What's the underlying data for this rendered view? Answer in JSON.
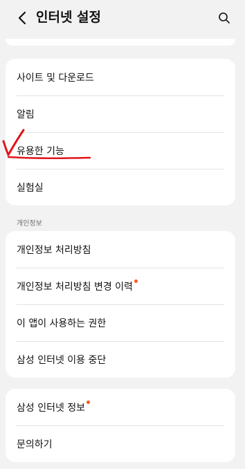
{
  "header": {
    "title": "인터넷 설정",
    "back_icon": "chevron-left-icon",
    "search_icon": "search-icon"
  },
  "group1": {
    "items": [
      {
        "label": "사이트 및 다운로드"
      },
      {
        "label": "알림"
      },
      {
        "label": "유용한 기능"
      },
      {
        "label": "실험실"
      }
    ]
  },
  "section2": {
    "label": "개인정보",
    "items": [
      {
        "label": "개인정보 처리방침"
      },
      {
        "label": "개인정보 처리방침 변경 이력"
      },
      {
        "label": "이 앱이 사용하는 권한"
      },
      {
        "label": "삼성 인터넷 이용 중단"
      }
    ]
  },
  "group3": {
    "items": [
      {
        "label": "삼성 인터넷 정보"
      },
      {
        "label": "문의하기"
      }
    ]
  },
  "colors": {
    "background": "#f2f2f2",
    "card": "#ffffff",
    "new_badge": "#ff5a1f",
    "annotation": "#e0141b"
  }
}
